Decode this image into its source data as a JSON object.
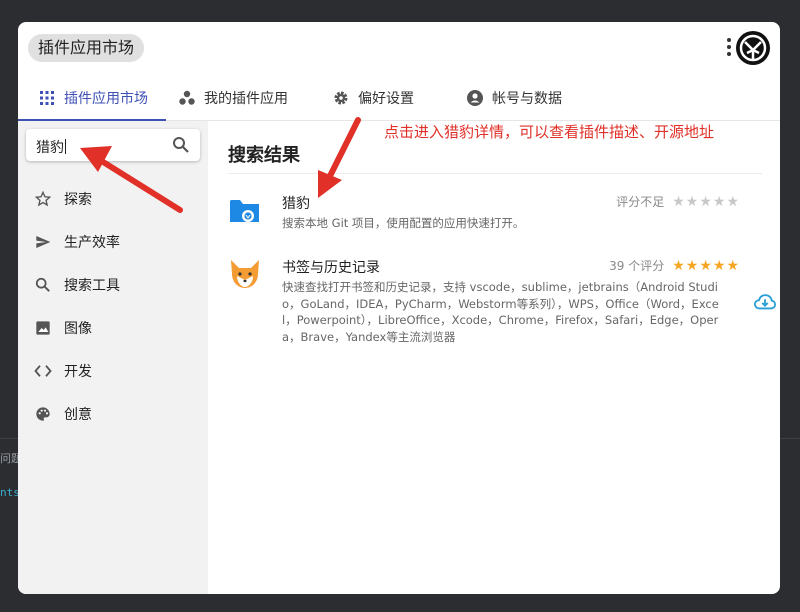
{
  "background": {
    "text_1": "问题",
    "text_2": "nts"
  },
  "window": {
    "title": "插件应用市场"
  },
  "tabs": [
    {
      "label": "插件应用市场",
      "icon": "grid-icon",
      "active": true
    },
    {
      "label": "我的插件应用",
      "icon": "bubbles-icon",
      "active": false
    },
    {
      "label": "偏好设置",
      "icon": "gear-icon",
      "active": false
    },
    {
      "label": "帐号与数据",
      "icon": "account-icon",
      "active": false
    }
  ],
  "search": {
    "value": "猎豹",
    "placeholder": ""
  },
  "sidebar": {
    "items": [
      {
        "label": "探索",
        "icon": "star-outline-icon"
      },
      {
        "label": "生产效率",
        "icon": "send-icon"
      },
      {
        "label": "搜索工具",
        "icon": "search-icon"
      },
      {
        "label": "图像",
        "icon": "image-icon"
      },
      {
        "label": "开发",
        "icon": "code-icon"
      },
      {
        "label": "创意",
        "icon": "palette-icon"
      }
    ]
  },
  "main": {
    "section_title": "搜索结果",
    "results": [
      {
        "name": "猎豹",
        "description": "搜索本地 Git 项目，使用配置的应用快速打开。",
        "rating_text": "评分不足",
        "stars": "★★★★★",
        "icon": "folder-icon"
      },
      {
        "name": "书签与历史记录",
        "description": "快速查找打开书签和历史记录，支持 vscode，sublime，jetbrains（Android Studio，GoLand，IDEA，PyCharm，Webstorm等系列），WPS，Office（Word，Excel，Powerpoint），LibreOffice，Xcode，Chrome，Firefox，Safari，Edge，Opera，Brave，Yandex等主流浏览器",
        "rating_text": "39 个评分",
        "stars": "★★★★★",
        "icon": "fox-icon",
        "action_icon": "cloud-download-icon"
      }
    ]
  },
  "annotation": {
    "text": "点击进入猎豹详情，可以查看插件描述、开源地址",
    "color": "#e03028"
  },
  "colors": {
    "accent": "#3f51b5",
    "star_filled": "#f6a623",
    "star_empty": "#c8c8c8",
    "download": "#2a9fd6"
  }
}
